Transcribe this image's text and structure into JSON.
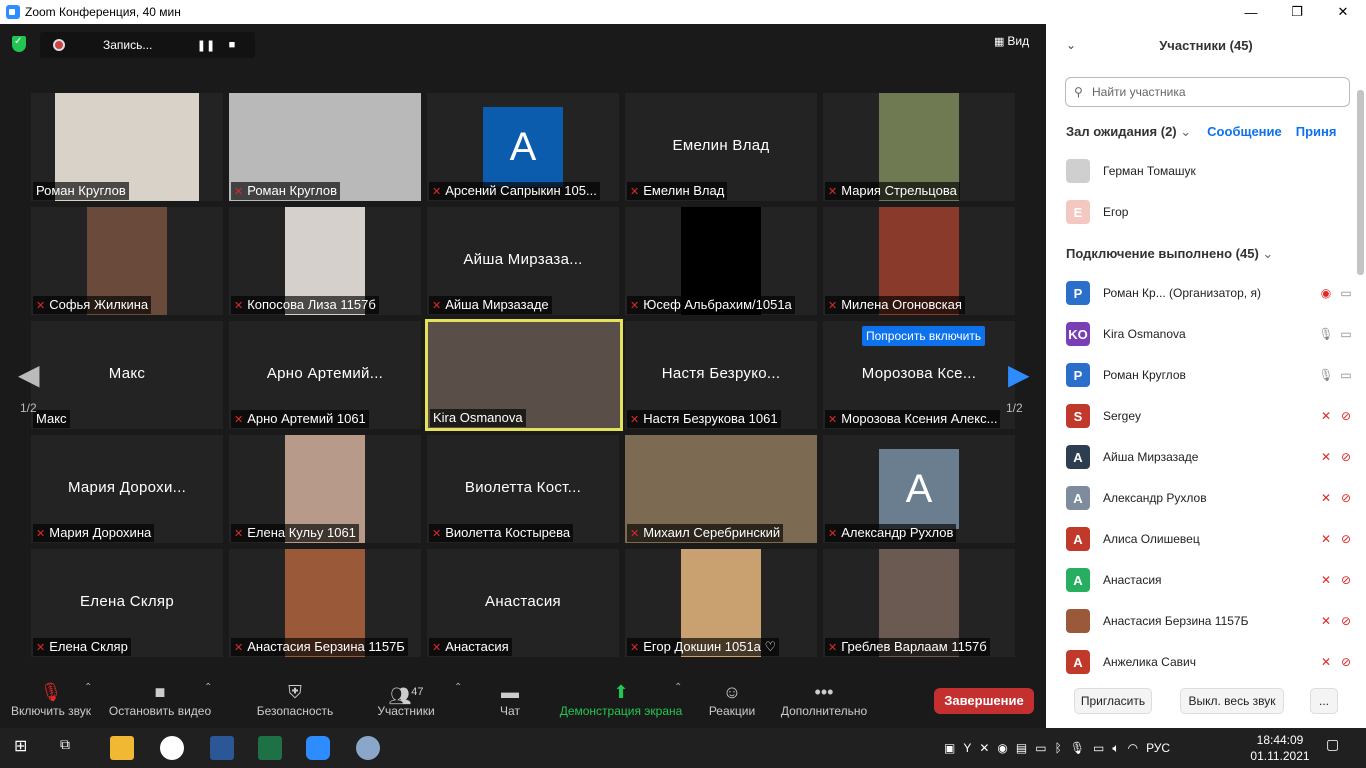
{
  "window": {
    "title": "Zoom Конференция, 40 мин",
    "min": "—",
    "max": "❐",
    "close": "✕"
  },
  "recording": {
    "label": "Запись...",
    "pause": "❚❚",
    "stop": "■"
  },
  "view": {
    "label": "Вид"
  },
  "pager": {
    "left": "1/2",
    "right": "1/2"
  },
  "ask_unmute": "Попросить включить",
  "tiles": [
    {
      "label": "Роман Круглов",
      "center": "",
      "muted": false,
      "kind": "photo",
      "color": "#d8d2c8"
    },
    {
      "label": "Роман Круглов",
      "center": "",
      "muted": true,
      "kind": "full",
      "color": "#b9b9b9"
    },
    {
      "label": "Арсений Сапрыкин 105...",
      "center": "",
      "muted": true,
      "kind": "avatar",
      "avatar": "A",
      "color": "#0b5cad"
    },
    {
      "label": "Емелин Влад",
      "center": "Емелин Влад",
      "muted": true,
      "kind": "name"
    },
    {
      "label": "Мария Стрельцова",
      "center": "",
      "muted": true,
      "kind": "photo",
      "color": "#6f7a52"
    },
    {
      "label": "Софья Жилкина",
      "center": "",
      "muted": true,
      "kind": "photo",
      "color": "#6a4a3a"
    },
    {
      "label": "Копосова Лиза 1157б",
      "center": "",
      "muted": true,
      "kind": "photo",
      "color": "#d6d0cc"
    },
    {
      "label": "Айша Мирзазаде",
      "center": "Айша Мирзаза...",
      "muted": true,
      "kind": "name"
    },
    {
      "label": "Юсеф Альбрахим/1051а",
      "center": "",
      "muted": true,
      "kind": "photo",
      "color": "#000000"
    },
    {
      "label": "Милена Огоновская",
      "center": "",
      "muted": true,
      "kind": "photo",
      "color": "#8a3a2a"
    },
    {
      "label": "Макс",
      "center": "Макс",
      "muted": false,
      "kind": "name"
    },
    {
      "label": "Арно Артемий 1061",
      "center": "Арно Артемий...",
      "muted": true,
      "kind": "name"
    },
    {
      "label": "Kira Osmanova",
      "center": "",
      "muted": false,
      "kind": "full",
      "color": "#5a4e48",
      "active": true
    },
    {
      "label": "Настя Безрукова 1061",
      "center": "Настя Безруко...",
      "muted": true,
      "kind": "name"
    },
    {
      "label": "Морозова Ксения Алекс...",
      "center": "Морозова Ксе...",
      "muted": true,
      "kind": "name"
    },
    {
      "label": "Мария Дорохина",
      "center": "Мария Дорохи...",
      "muted": true,
      "kind": "name"
    },
    {
      "label": "Елена Кульу 1061",
      "center": "",
      "muted": true,
      "kind": "photo",
      "color": "#b89a8a"
    },
    {
      "label": "Виолетта Костырева",
      "center": "Виолетта Кост...",
      "muted": true,
      "kind": "name"
    },
    {
      "label": "Михаил Серебринский",
      "center": "",
      "muted": true,
      "kind": "full",
      "color": "#7c6a52"
    },
    {
      "label": "Александр Рухлов",
      "center": "",
      "muted": true,
      "kind": "avatar",
      "avatar": "A",
      "color": "#6b7e8f"
    },
    {
      "label": "Елена Скляр",
      "center": "Елена Скляр",
      "muted": true,
      "kind": "name"
    },
    {
      "label": "Анастасия Берзина 1157Б",
      "center": "",
      "muted": true,
      "kind": "photo",
      "color": "#9a5a3a"
    },
    {
      "label": "Анастасия",
      "center": "Анастасия",
      "muted": true,
      "kind": "name"
    },
    {
      "label": "Егор Докшин 1051а ♡",
      "center": "",
      "muted": true,
      "kind": "photo",
      "color": "#c9a070"
    },
    {
      "label": "Греблев Варлаам 1157б",
      "center": "",
      "muted": true,
      "kind": "photo",
      "color": "#6b5a52"
    }
  ],
  "toolbar": {
    "mute": "Включить звук",
    "video": "Остановить видео",
    "security": "Безопасность",
    "participants": "Участники",
    "participants_count": "47",
    "chat": "Чат",
    "share": "Демонстрация экрана",
    "reactions": "Реакции",
    "more": "Дополнительно",
    "end": "Завершение"
  },
  "panel": {
    "title": "Участники (45)",
    "search_placeholder": "Найти участника",
    "waiting_title": "Зал ожидания (2)",
    "waiting_message": "Сообщение",
    "waiting_admit": "Приня",
    "waiting": [
      {
        "name": "Герман Томашук",
        "initial": "",
        "color": "#cfcfcf"
      },
      {
        "name": "Егор",
        "initial": "Е",
        "color": "#f4c7c0"
      }
    ],
    "connected_title": "Подключение выполнено (45)",
    "participants": [
      {
        "name": "Роман Кр...  (Организатор, я)",
        "initial": "Р",
        "color": "#2a6fc9",
        "mic": "rec",
        "cam": "on"
      },
      {
        "name": "Kira Osmanova",
        "initial": "KO",
        "color": "#7b3fb5",
        "mic": "on",
        "cam": "on"
      },
      {
        "name": "Роман Круглов",
        "initial": "Р",
        "color": "#2a6fc9",
        "mic": "on",
        "cam": "on"
      },
      {
        "name": "Sergey",
        "initial": "S",
        "color": "#c0392b",
        "mic": "off",
        "cam": "off"
      },
      {
        "name": "Айша Мирзазаде",
        "initial": "А",
        "color": "#2c3e50",
        "mic": "off",
        "cam": "off"
      },
      {
        "name": "Александр Рухлов",
        "initial": "А",
        "color": "#7f8c9d",
        "mic": "off",
        "cam": "off"
      },
      {
        "name": "Алиса Олишевец",
        "initial": "А",
        "color": "#c0392b",
        "mic": "off",
        "cam": "off"
      },
      {
        "name": "Анастасия",
        "initial": "А",
        "color": "#27ae60",
        "mic": "off",
        "cam": "off"
      },
      {
        "name": "Анастасия Берзина 1157Б",
        "initial": "",
        "color": "#9a5a3a",
        "mic": "off",
        "cam": "off"
      },
      {
        "name": "Анжелика Савич",
        "initial": "А",
        "color": "#c0392b",
        "mic": "off",
        "cam": "off"
      }
    ],
    "invite": "Пригласить",
    "mute_all": "Выкл. весь звук",
    "more": "..."
  },
  "taskbar": {
    "lang": "РУС",
    "time": "18:44:09",
    "date": "01.11.2021"
  }
}
